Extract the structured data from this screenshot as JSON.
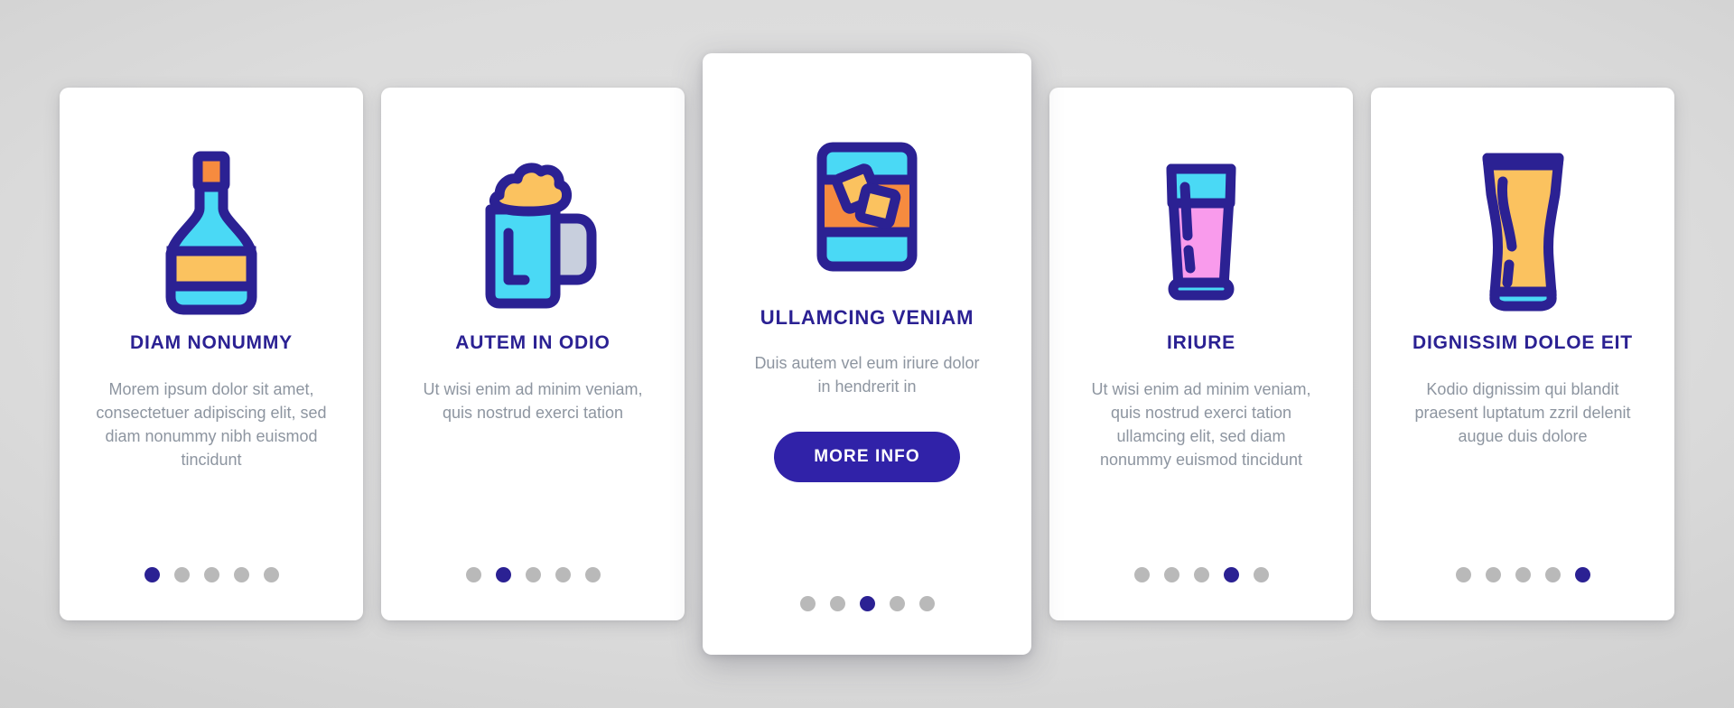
{
  "theme": {
    "accent": "#2b2193",
    "button_bg": "#3022a8",
    "body_text": "#8d95a0",
    "dot_inactive": "#b9b9b9",
    "card_bg": "#ffffff",
    "icon_outline": "#2b2193",
    "icon_cyan": "#4ad9f5",
    "icon_yellow": "#fbc25f",
    "icon_orange": "#f68b3f",
    "icon_pink": "#f99bec",
    "icon_grey": "#c8cfdd"
  },
  "cards": [
    {
      "icon": "liquor-bottle-icon",
      "title": "DIAM NONUMMY",
      "description": "Morem ipsum dolor sit amet, consectetuer adipiscing elit, sed diam nonummy nibh euismod tincidunt",
      "dots": {
        "count": 5,
        "active_index": 0
      },
      "featured": false,
      "button_label": null
    },
    {
      "icon": "beer-mug-icon",
      "title": "AUTEM IN ODIO",
      "description": "Ut wisi enim ad minim veniam, quis nostrud exerci tation",
      "dots": {
        "count": 5,
        "active_index": 1
      },
      "featured": false,
      "button_label": null
    },
    {
      "icon": "whiskey-glass-ice-icon",
      "title": "ULLAMCING VENIAM",
      "description": "Duis autem vel eum iriure dolor in hendrerit in",
      "dots": {
        "count": 5,
        "active_index": 2
      },
      "featured": true,
      "button_label": "MORE INFO"
    },
    {
      "icon": "tall-drink-glass-icon",
      "title": "IRIURE",
      "description": "Ut wisi enim ad minim veniam, quis nostrud exerci tation ullamcing elit, sed diam nonummy euismod tincidunt",
      "dots": {
        "count": 5,
        "active_index": 3
      },
      "featured": false,
      "button_label": null
    },
    {
      "icon": "weizen-beer-glass-icon",
      "title": "DIGNISSIM DOLOE EIT",
      "description": "Kodio dignissim qui blandit praesent luptatum zzril delenit augue duis dolore",
      "dots": {
        "count": 5,
        "active_index": 4
      },
      "featured": false,
      "button_label": null
    }
  ]
}
